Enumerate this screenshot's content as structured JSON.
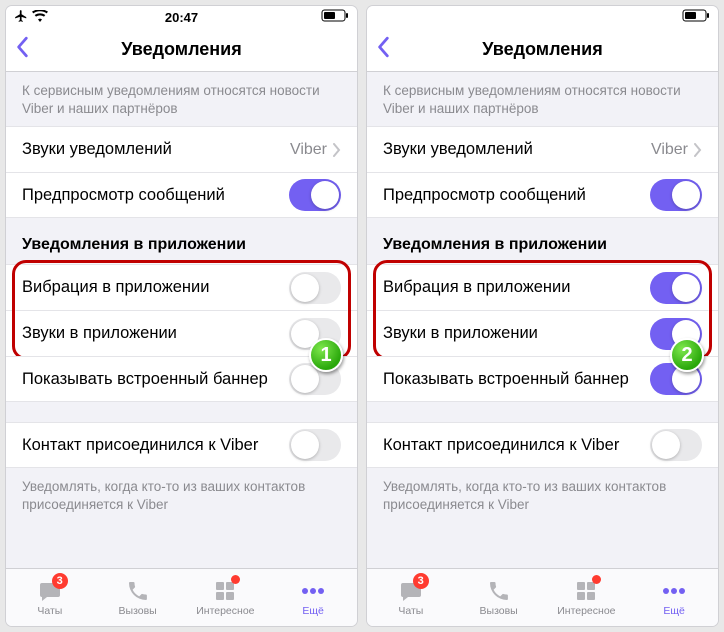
{
  "status": {
    "time": "20:47"
  },
  "nav": {
    "title": "Уведомления"
  },
  "sections": {
    "service_footer": "К сервисным уведомлениям относятся новости Viber и наших партнёров",
    "sounds_label": "Звуки уведомлений",
    "sounds_value": "Viber",
    "preview_label": "Предпросмотр сообщений",
    "inapp_header": "Уведомления в приложении",
    "vibration_label": "Вибрация в приложении",
    "inapp_sounds_label": "Звуки в приложении",
    "banner_label": "Показывать встроенный баннер",
    "contact_joined_label": "Контакт присоединился к Viber",
    "contact_joined_footer": "Уведомлять, когда кто-то из ваших контактов присоединяется к Viber"
  },
  "tabs": {
    "chats": "Чаты",
    "calls": "Вызовы",
    "interesting": "Интересное",
    "more": "Ещё",
    "chats_badge": "3"
  },
  "screens": [
    {
      "step": "1",
      "vibration_on": false,
      "inapp_sounds_on": false,
      "banner_on": false
    },
    {
      "step": "2",
      "vibration_on": true,
      "inapp_sounds_on": true,
      "banner_on": true
    }
  ]
}
